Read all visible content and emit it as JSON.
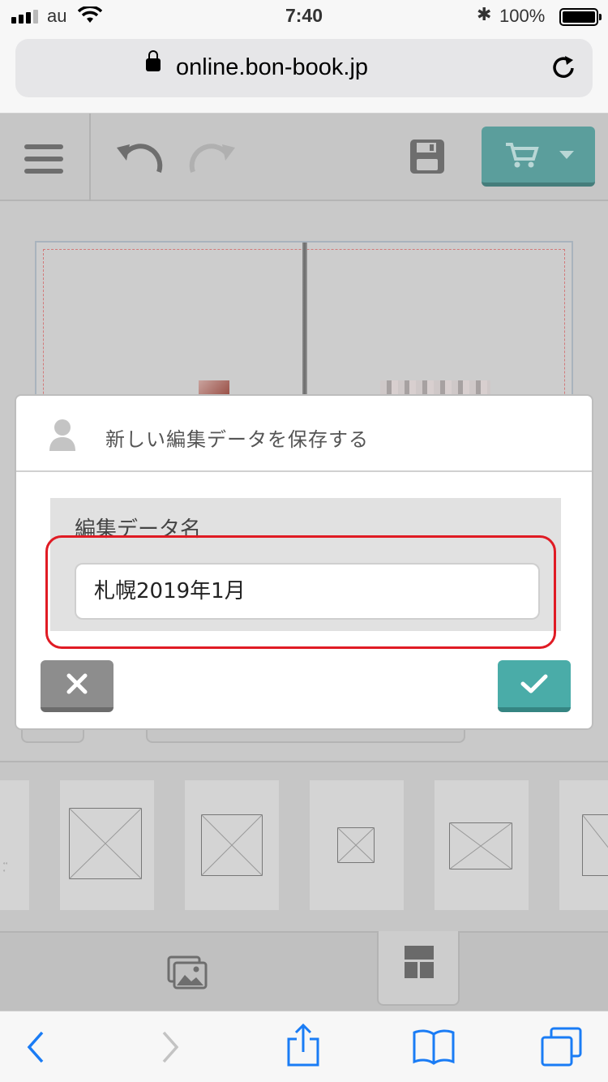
{
  "status_bar": {
    "carrier": "au",
    "time": "7:40",
    "battery_percent": "100%"
  },
  "browser": {
    "url": "online.bon-book.jp"
  },
  "app_toolbar": {
    "accent_color": "#5b9e9c"
  },
  "dialog": {
    "title": "新しい編集データを保存する",
    "field_label": "編集データ名",
    "field_value": "札幌2019年1月",
    "cancel_color": "#8d8d8d",
    "confirm_color": "#4aaca8",
    "highlight_color": "#e01b24"
  },
  "safari_bottom_bar": {
    "items": [
      "back-icon",
      "forward-icon",
      "share-icon",
      "bookmarks-icon",
      "tabs-icon"
    ]
  }
}
